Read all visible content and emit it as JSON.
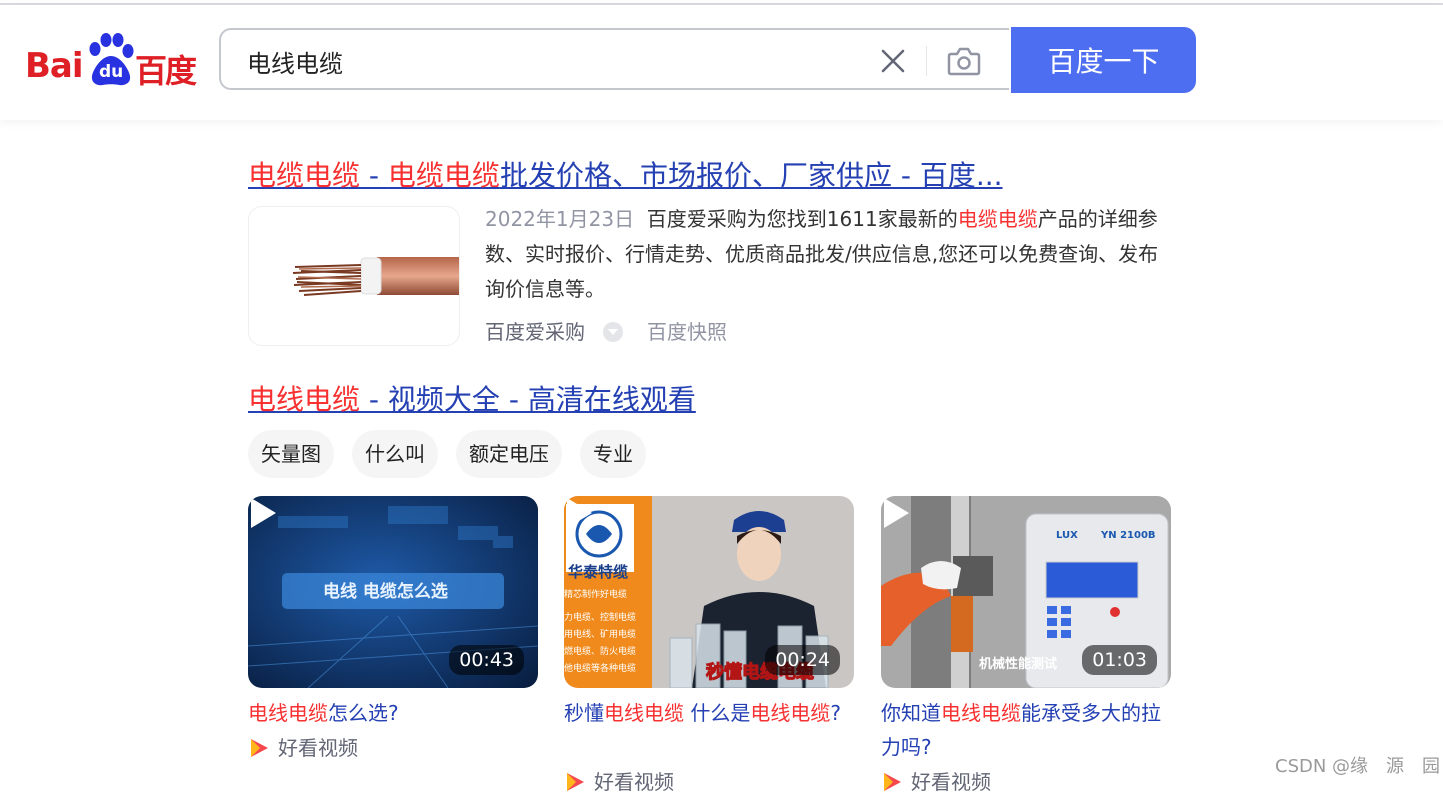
{
  "search": {
    "query": "电线电缆",
    "button_label": "百度一下"
  },
  "logo": {
    "left": "Bai",
    "mid": "du",
    "right": "百度"
  },
  "results": [
    {
      "title_parts": [
        {
          "text": "电缆电缆",
          "em": true
        },
        {
          "text": " - ",
          "em": false
        },
        {
          "text": "电缆电缆",
          "em": true
        },
        {
          "text": "批发价格、市场报价、厂家供应 - 百度...",
          "em": false
        }
      ],
      "date": "2022年1月23日",
      "abstract_parts": [
        {
          "text": "百度爱采购为您找到1611家最新的",
          "em": false
        },
        {
          "text": "电缆电缆",
          "em": true
        },
        {
          "text": "产品的详细参数、实时报价、行情走势、优质商品批发/供应信息,您还可以免费查询、发布询价信息等。",
          "em": false
        }
      ],
      "source": "百度爱采购",
      "snapshot": "百度快照"
    },
    {
      "title_parts": [
        {
          "text": "电线电缆",
          "em": true
        },
        {
          "text": " - 视频大全 - 高清在线观看",
          "em": false
        }
      ]
    }
  ],
  "tags": [
    "矢量图",
    "什么叫",
    "额定电压",
    "专业"
  ],
  "videos": [
    {
      "duration": "00:43",
      "caption": "电线 电缆怎么选",
      "title_parts": [
        {
          "text": "电线电缆",
          "em": true
        },
        {
          "text": "怎么选?",
          "em": false
        }
      ],
      "source": "好看视频"
    },
    {
      "duration": "00:24",
      "brand": "华泰特缆",
      "brand_sub": "精芯制作好电缆",
      "list": [
        "力电缆、控制电缆",
        "用电线、矿用电缆",
        "燃电缆、防火电缆",
        "他电缆等各种电缆"
      ],
      "caption": "秒懂电缆电缆",
      "title_parts": [
        {
          "text": "秒懂",
          "em": false
        },
        {
          "text": "电线电缆",
          "em": true
        },
        {
          "text": " 什么是",
          "em": false
        },
        {
          "text": "电线电缆",
          "em": true
        },
        {
          "text": "?",
          "em": false
        }
      ],
      "source": "好看视频"
    },
    {
      "duration": "01:03",
      "caption": "机械性能测试",
      "machine_brand": "LUX",
      "machine_model": "YN 2100B",
      "title_parts": [
        {
          "text": "你知道",
          "em": false
        },
        {
          "text": "电线电缆",
          "em": true
        },
        {
          "text": "能承受多大的拉力吗?",
          "em": false
        }
      ],
      "source": "好看视频"
    }
  ],
  "watermark": "CSDN @缘　源　园",
  "colors": {
    "accent": "#4e6ef2",
    "link": "#2440b3",
    "highlight": "#f73131",
    "logo_red": "#de1f26",
    "logo_blue": "#2932e1"
  }
}
